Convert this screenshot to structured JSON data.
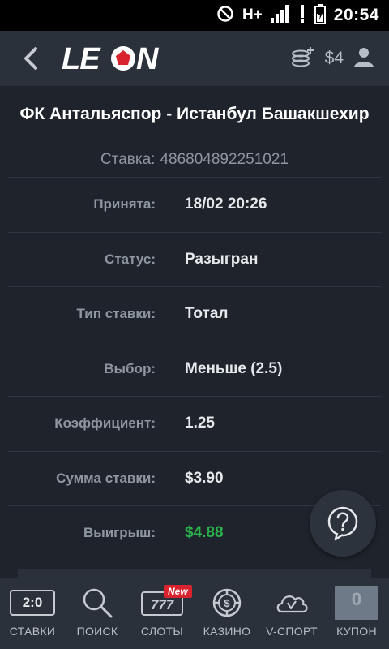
{
  "statusbar": {
    "network": "H+",
    "time": "20:54"
  },
  "header": {
    "logo": "LEON",
    "balance": "$4"
  },
  "bet": {
    "match_title": "ФК Антальяспор - Истанбул Башакшехир",
    "id_label": "Ставка:",
    "id_value": "486804892251021",
    "rows": [
      {
        "label": "Принята:",
        "value": "18/02 20:26"
      },
      {
        "label": "Статус:",
        "value": "Разыгран"
      },
      {
        "label": "Тип ставки:",
        "value": "Тотал"
      },
      {
        "label": "Выбор:",
        "value": "Меньше (2.5)"
      },
      {
        "label": "Коэффициент:",
        "value": "1.25"
      },
      {
        "label": "Сумма ставки:",
        "value": "$3.90"
      },
      {
        "label": "Выигрыш:",
        "value": "$4.88"
      }
    ],
    "win_color": "#2bb24c"
  },
  "nav": {
    "items": [
      {
        "label": "СТАВКИ",
        "icon": "score-icon",
        "icon_text": "2:0"
      },
      {
        "label": "ПОИСК",
        "icon": "search-icon"
      },
      {
        "label": "СЛОТЫ",
        "icon": "slots-icon",
        "icon_text": "777",
        "badge": "New"
      },
      {
        "label": "КАЗИНО",
        "icon": "casino-chip-icon"
      },
      {
        "label": "V-СПОРТ",
        "icon": "cloud-icon"
      },
      {
        "label": "КУПОН",
        "icon": "coupon-icon",
        "count": "0"
      }
    ]
  },
  "colors": {
    "background": "#1f242c",
    "header": "#2b313b",
    "accent_red": "#d9232f"
  }
}
